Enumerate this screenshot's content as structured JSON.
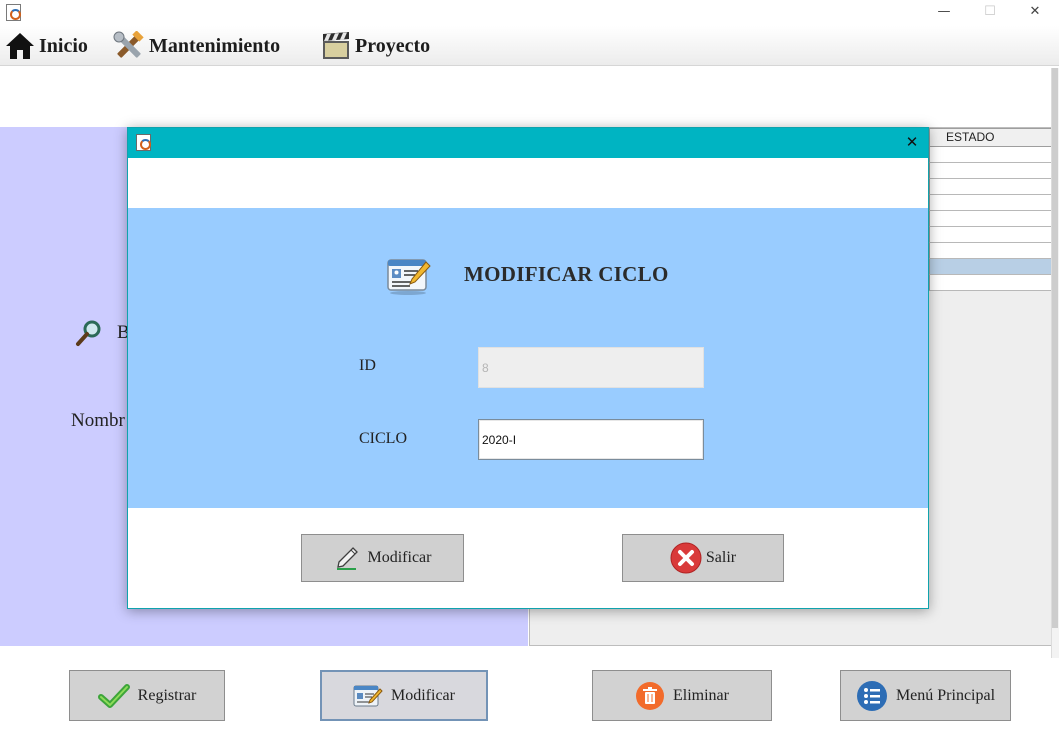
{
  "window": {
    "minimize_glyph": "—",
    "maximize_glyph": "☐",
    "close_glyph": "✕"
  },
  "menu": [
    {
      "label": "Inicio",
      "icon": "home-icon"
    },
    {
      "label": "Mantenimiento",
      "icon": "tools-icon"
    },
    {
      "label": "Proyecto",
      "icon": "clapperboard-icon"
    }
  ],
  "background_form": {
    "search_label_partial": "B",
    "name_label_partial": "Nombr"
  },
  "table": {
    "header": "ESTADO",
    "selected_row_index": 7
  },
  "dialog": {
    "title": "MODIFICAR CICLO",
    "close_glyph": "✕",
    "fields": {
      "id": {
        "label": "ID",
        "value": "8"
      },
      "ciclo": {
        "label": "CICLO",
        "value": "2020-I"
      }
    },
    "buttons": {
      "modify_label": "Modificar",
      "exit_label": "Salir"
    }
  },
  "bottom_buttons": {
    "register_label": "Registrar",
    "modify_label": "Modificar",
    "delete_label": "Eliminar",
    "main_menu_label": "Menú Principal"
  },
  "colors": {
    "dialog_title_bar": "#00b4c2",
    "dialog_form_bg": "#99ccff",
    "left_panel_bg": "#ccccff",
    "exit_icon_red": "#d93a3a",
    "delete_icon_orange": "#f26b2b",
    "menu_icon_blue": "#2d6db5"
  }
}
